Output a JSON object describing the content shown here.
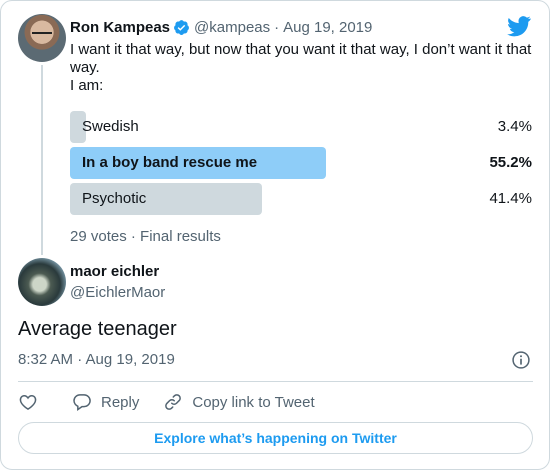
{
  "parent_tweet": {
    "author_name": "Ron Kampeas",
    "handle": "@kampeas",
    "separator": "·",
    "date": "Aug 19, 2019",
    "text_line1": "I want it that way, but now that you want it that way, I don’t want it that way.",
    "text_line2": "I am:",
    "poll": {
      "options": [
        {
          "label": "Swedish",
          "percent_text": "3.4%",
          "fraction": 0.034
        },
        {
          "label": "In a boy band rescue me",
          "percent_text": "55.2%",
          "fraction": 0.552
        },
        {
          "label": "Psychotic",
          "percent_text": "41.4%",
          "fraction": 0.414
        }
      ],
      "meta": "29 votes · Final results"
    }
  },
  "reply_tweet": {
    "author_name": "maor eichler",
    "handle": "@EichlerMaor",
    "text": "Average teenager",
    "timestamp": "8:32 AM · Aug 19, 2019"
  },
  "actions": {
    "reply_label": "Reply",
    "copy_label": "Copy link to Tweet"
  },
  "explore_label": "Explore what’s happening on Twitter",
  "colors": {
    "accent": "#1d9bf0",
    "poll_winner": "#8ecdf8",
    "poll_other": "#cfd9de",
    "muted_text": "#536471"
  }
}
